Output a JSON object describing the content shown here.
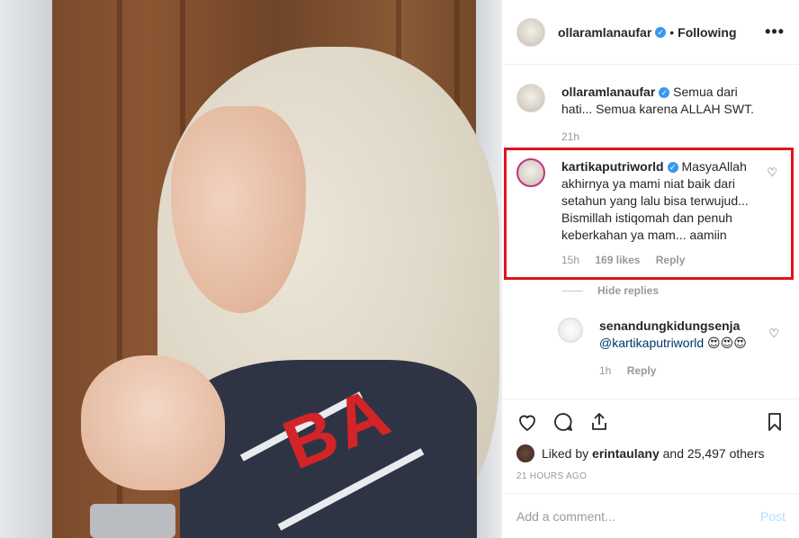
{
  "header": {
    "username": "ollaramlanaufar",
    "separator": "•",
    "follow_status": "Following",
    "more_label": "•••"
  },
  "caption": {
    "username": "ollaramlanaufar",
    "text": "Semua dari hati... Semua karena ALLAH SWT.",
    "time": "21h"
  },
  "comments": [
    {
      "username": "kartikaputriworld",
      "text": "MasyaAllah akhirnya ya mami niat baik dari setahun yang lalu bisa terwujud... Bismillah istiqomah dan penuh keberkahan ya mam... aamiin",
      "time": "15h",
      "likes": "169 likes",
      "reply": "Reply"
    }
  ],
  "hide_replies": "Hide replies",
  "replies": [
    {
      "username": "senandungkidungsenja",
      "mention": "@kartikaputriworld",
      "emoji": "😍😍😍",
      "time": "1h",
      "reply": "Reply"
    }
  ],
  "liked_by": {
    "prefix": "Liked by",
    "user": "erintaulany",
    "suffix": "and 25,497 others"
  },
  "post_time": "21 HOURS AGO",
  "add_comment": {
    "placeholder": "Add a comment...",
    "post_label": "Post"
  },
  "photo": {
    "text_on_shirt": "BA"
  },
  "colors": {
    "highlight_border": "#e0131b",
    "verified": "#3897f0",
    "link": "#003569",
    "post_button": "#b2dffc"
  }
}
